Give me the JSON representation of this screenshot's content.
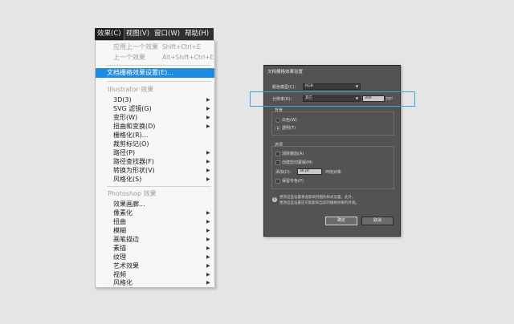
{
  "menubar": {
    "items": [
      "效果(C)",
      "视图(V)",
      "窗口(W)",
      "帮助(H)"
    ]
  },
  "menu": {
    "apply_last": {
      "label": "应用上一个效果",
      "shortcut": "Shift+Ctrl+E"
    },
    "last_effect": {
      "label": "上一个效果",
      "shortcut": "Alt+Shift+Ctrl+E"
    },
    "raster_settings": "文档栅格效果设置(E)...",
    "illustrator_header": "Illustrator 效果",
    "illustrator_items": [
      "3D(3)",
      "SVG 滤镜(G)",
      "变形(W)",
      "扭曲和变换(D)",
      "栅格化(R)...",
      "裁剪标记(O)",
      "路径(P)",
      "路径查找器(F)",
      "转换为形状(V)",
      "风格化(S)"
    ],
    "photoshop_header": "Photoshop 效果",
    "photoshop_items": [
      "效果画廊...",
      "像素化",
      "扭曲",
      "模糊",
      "画笔描边",
      "素描",
      "纹理",
      "艺术效果",
      "视频",
      "风格化"
    ]
  },
  "dialog": {
    "title": "文档栅格效果设置",
    "color_model_label": "颜色模型(C)：",
    "color_model_value": "RGB",
    "resolution_label": "分辨率(R)：",
    "resolution_value": "其它",
    "ppi_value": "300",
    "ppi_unit": "ppi",
    "background_header": "背景",
    "bg_white": "白色(W)",
    "bg_transparent": "透明(T)",
    "options_header": "选项",
    "opt_antialias": "消除锯齿(A)",
    "opt_clipping_mask": "创建剪切蒙版(M)",
    "opt_add_label": "添加(D)：",
    "opt_add_value": "36 pt",
    "opt_add_suffix": "环绕对象",
    "opt_spot": "保留专色(P)",
    "note_line1": "更改这些设置将会影响到图形样式设置。此外，",
    "note_line2": "更改这些设置还可能影响当前的栅格效果的外观。",
    "ok": "确定",
    "cancel": "取消"
  },
  "colors": {
    "highlight": "#1e8ae0",
    "callout": "#3ba4e0",
    "dialog_bg": "#535353"
  },
  "icons": {
    "submenu": "triangle-right-icon",
    "info": "info-icon",
    "dropdown": "chevron-down-icon"
  }
}
